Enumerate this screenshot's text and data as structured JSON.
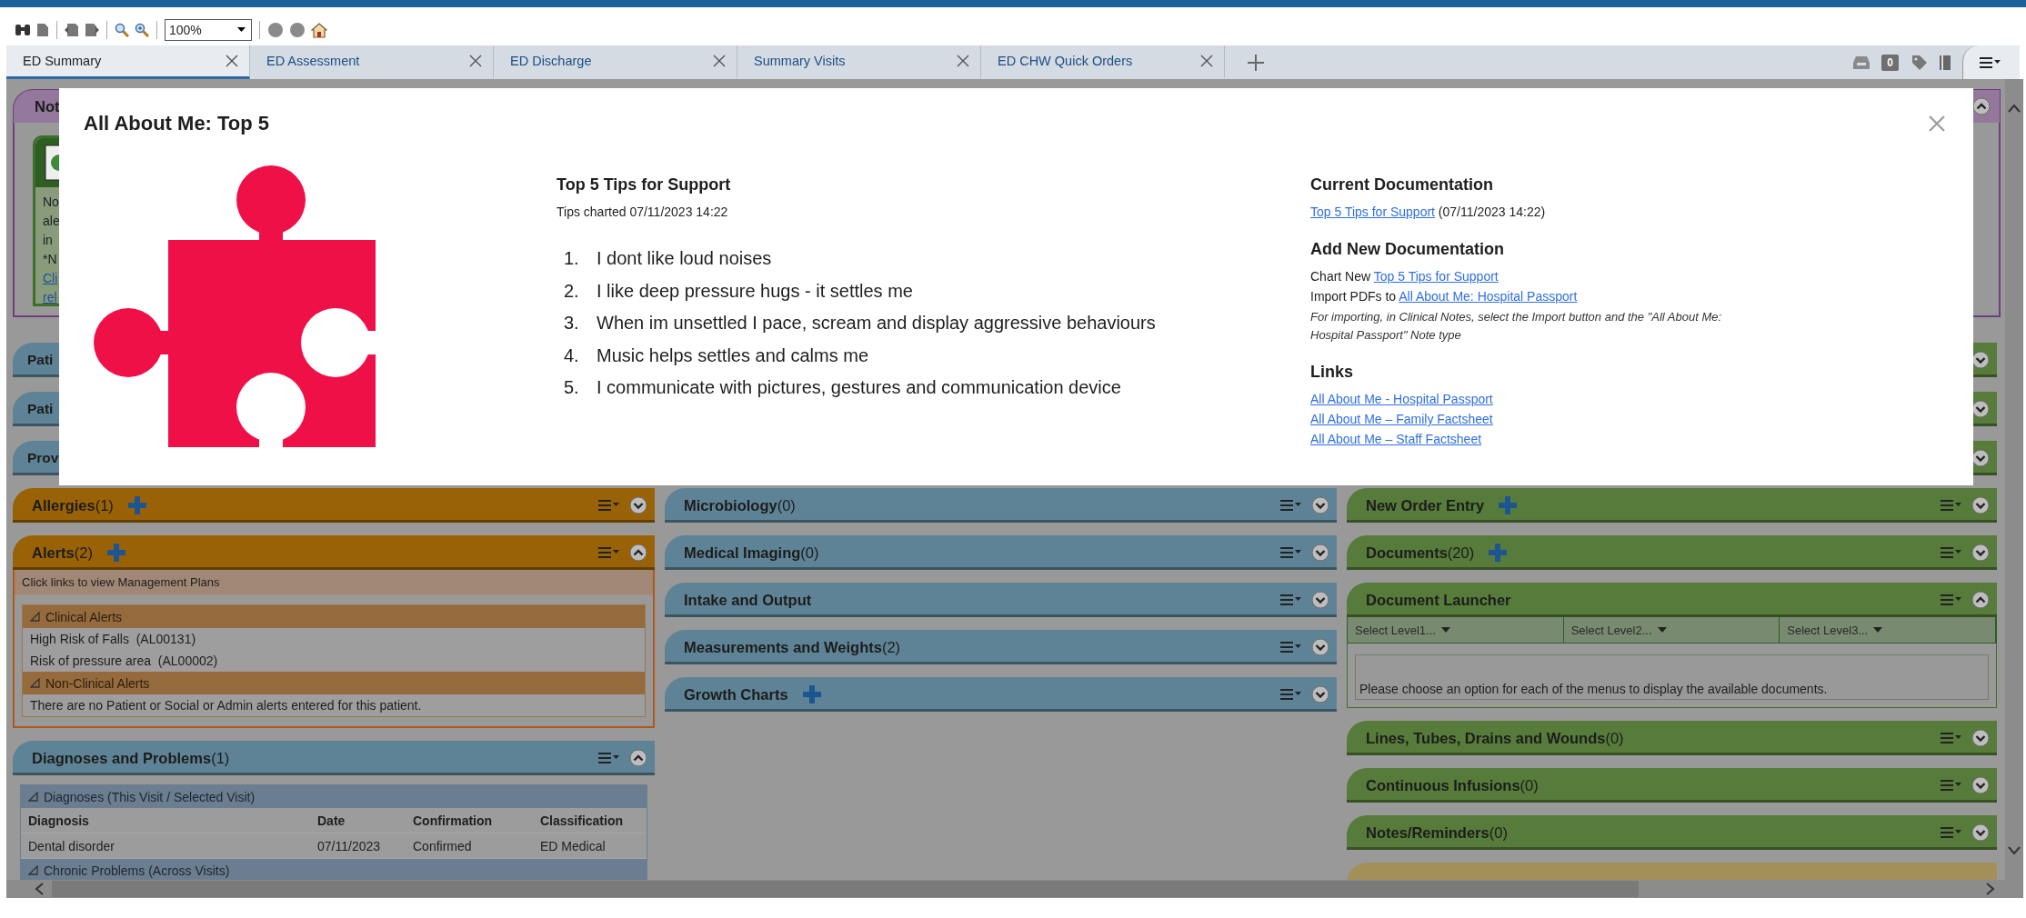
{
  "toolbar": {
    "zoom": "100%"
  },
  "tabs": [
    {
      "label": "ED Summary",
      "selected": true
    },
    {
      "label": "ED Assessment",
      "selected": false
    },
    {
      "label": "ED Discharge",
      "selected": false
    },
    {
      "label": "Summary Visits",
      "selected": false
    },
    {
      "label": "ED CHW Quick Orders",
      "selected": false
    }
  ],
  "inbox_count": "0",
  "background": {
    "notifications": {
      "title": "Not",
      "expanded": true,
      "lines": [
        {
          "text": "No",
          "link": false
        },
        {
          "text": "ale",
          "link": false
        },
        {
          "text": "in",
          "link": false
        },
        {
          "text": "*N",
          "link": false
        },
        {
          "text": "Cli",
          "link": true
        },
        {
          "text": "rel",
          "link": true
        }
      ]
    },
    "rows": [
      {
        "title": "Pati",
        "expanded": false
      },
      {
        "title": "Pati",
        "expanded": false
      },
      {
        "title": "Prov",
        "expanded": false
      }
    ],
    "columns": [
      {
        "panels": [
          {
            "kind": "plain",
            "title": "Allergies",
            "count": "(1)",
            "add": true,
            "expanded": false,
            "color": "#9a6207"
          },
          {
            "kind": "alerts",
            "title": "Alerts",
            "count": "(2)",
            "add": true,
            "expanded": true,
            "color": "#9a6207",
            "note": "Click links to view Management Plans",
            "groups": [
              {
                "title": "Clinical Alerts",
                "items": [
                  "High Risk of Falls  (AL00131)",
                  "Risk of pressure area  (AL00002)"
                ]
              },
              {
                "title": "Non-Clinical Alerts",
                "items": [
                  "There are no Patient or Social or Admin alerts entered for this patient."
                ]
              }
            ]
          },
          {
            "kind": "diagnoses",
            "title": "Diagnoses and Problems",
            "count": "(1)",
            "add": false,
            "expanded": true,
            "color": "#5f8396",
            "groups": [
              {
                "title": "Diagnoses (This Visit / Selected Visit)",
                "columns": [
                  "Diagnosis",
                  "Date",
                  "Confirmation",
                  "Classification"
                ],
                "rows": [
                  [
                    "Dental disorder",
                    "07/11/2023",
                    "Confirmed",
                    "ED Medical"
                  ]
                ]
              },
              {
                "title": "Chronic Problems (Across Visits)"
              }
            ]
          }
        ]
      },
      {
        "panels": [
          {
            "kind": "plain",
            "title": "Microbiology",
            "count": "(0)",
            "add": false,
            "expanded": false,
            "color": "#5f8396"
          },
          {
            "kind": "plain",
            "title": "Medical Imaging",
            "count": "(0)",
            "add": false,
            "expanded": false,
            "color": "#5f8396"
          },
          {
            "kind": "plain",
            "title": "Intake and Output",
            "add": false,
            "expanded": false,
            "color": "#5f8396"
          },
          {
            "kind": "plain",
            "title": "Measurements and Weights",
            "count": "(2)",
            "add": false,
            "expanded": false,
            "color": "#5f8396"
          },
          {
            "kind": "plain",
            "title": "Growth Charts",
            "add": true,
            "expanded": false,
            "color": "#5f8396"
          }
        ]
      },
      {
        "panels": [
          {
            "kind": "plain",
            "title": "New Order Entry",
            "add": true,
            "expanded": false,
            "color": "#567b3a"
          },
          {
            "kind": "plain",
            "title": "Documents",
            "count": "(20)",
            "add": true,
            "expanded": false,
            "color": "#567b3a"
          },
          {
            "kind": "launcher",
            "title": "Document Launcher",
            "add": false,
            "expanded": true,
            "color": "#567b3a",
            "selects": [
              "Select Level1...",
              "Select Level2...",
              "Select Level3..."
            ],
            "message": "Please choose an option for each of the menus to display the available documents."
          },
          {
            "kind": "plain",
            "title": "Lines, Tubes, Drains and Wounds",
            "count": "(0)",
            "add": false,
            "expanded": false,
            "color": "#567b3a"
          },
          {
            "kind": "plain",
            "title": "Continuous Infusions",
            "count": "(0)",
            "add": false,
            "expanded": false,
            "color": "#567b3a"
          },
          {
            "kind": "plain",
            "title": "Notes/Reminders",
            "count": "(0)",
            "add": false,
            "expanded": false,
            "color": "#567b3a"
          },
          {
            "kind": "cutoff",
            "color": "#a39059"
          }
        ]
      }
    ]
  },
  "modal": {
    "title": "All About Me: Top 5",
    "tips": {
      "heading": "Top 5 Tips for Support",
      "charted": "Tips charted 07/11/2023 14:22",
      "items": [
        {
          "number": "1.",
          "text": "I dont like loud noises"
        },
        {
          "number": "2.",
          "text": "I like deep pressure hugs - it settles me"
        },
        {
          "number": "3.",
          "text": "When im unsettled I pace, scream and display aggressive behaviours"
        },
        {
          "number": "4.",
          "text": "Music helps settles and calms me"
        },
        {
          "number": "5.",
          "text": "I communicate with pictures, gestures and communication device"
        }
      ]
    },
    "current": {
      "heading": "Current Documentation",
      "link": "Top 5 Tips for Support",
      "text": "(07/11/2023 14:22)"
    },
    "add_new": {
      "heading": "Add New Documentation",
      "lines": [
        {
          "prefix": "Chart New",
          "link": "Top 5 Tips for Support"
        },
        {
          "prefix": "Import PDFs to",
          "link": "All About Me: Hospital Passport"
        }
      ],
      "note": "For importing, in Clinical Notes, select the Import button and the \"All About Me: Hospital Passport\" Note type"
    },
    "links": {
      "heading": "Links",
      "items": [
        "All About Me - Hospital Passport",
        "All About Me – Family Factsheet",
        "All About Me – Staff Factsheet"
      ]
    }
  }
}
